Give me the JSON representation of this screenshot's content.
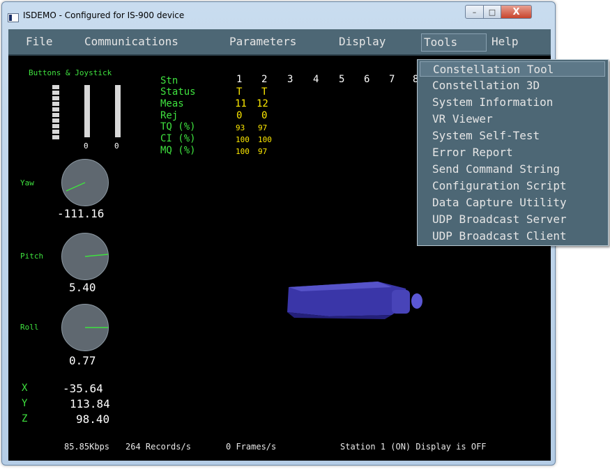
{
  "window": {
    "title": "ISDEMO - Configured for IS-900 device",
    "min": "–",
    "max": "□",
    "close": "X"
  },
  "menubar": [
    "File",
    "Communications",
    "Parameters",
    "Display",
    "Tools",
    "Help"
  ],
  "tools_menu": [
    "Constellation Tool",
    "Constellation 3D",
    "System Information",
    "VR Viewer",
    "System Self-Test",
    "Error Report",
    "Send Command String",
    "Configuration Script",
    "Data Capture Utility",
    "UDP Broadcast Server",
    "UDP Broadcast Client"
  ],
  "buttons_joystick": {
    "label": "Buttons & Joystick",
    "joy_x": "0",
    "joy_y": "0"
  },
  "stations": {
    "headers": [
      "Stn",
      "1",
      "2",
      "3",
      "4",
      "5",
      "6",
      "7",
      "8"
    ],
    "rows": [
      {
        "label": "Status",
        "values": [
          "T",
          "T"
        ]
      },
      {
        "label": "Meas",
        "values": [
          "11",
          "12"
        ]
      },
      {
        "label": "Rej",
        "values": [
          "0",
          "0"
        ]
      },
      {
        "label": "TQ (%)",
        "values": [
          "93",
          "97"
        ]
      },
      {
        "label": "CI (%)",
        "values": [
          "100",
          "100"
        ]
      },
      {
        "label": "MQ (%)",
        "values": [
          "100",
          "97"
        ]
      }
    ]
  },
  "orientation": {
    "yaw": {
      "label": "Yaw",
      "value": "-111.16"
    },
    "pitch": {
      "label": "Pitch",
      "value": "5.40"
    },
    "roll": {
      "label": "Roll",
      "value": "0.77"
    }
  },
  "position": {
    "x": {
      "label": "X",
      "value": "-35.64"
    },
    "y": {
      "label": "Y",
      "value": "113.84"
    },
    "z": {
      "label": "Z",
      "value": "98.40"
    }
  },
  "status": {
    "rate": "85.85Kbps",
    "records": "264 Records/s",
    "frames": "0 Frames/s",
    "station": "Station 1 (ON) Display is OFF"
  },
  "colors": {
    "menu_bg": "#4d6775",
    "readout_green": "#3fe23f",
    "value_yellow": "#ffea00",
    "tracker_blue": "#3a36a8"
  }
}
